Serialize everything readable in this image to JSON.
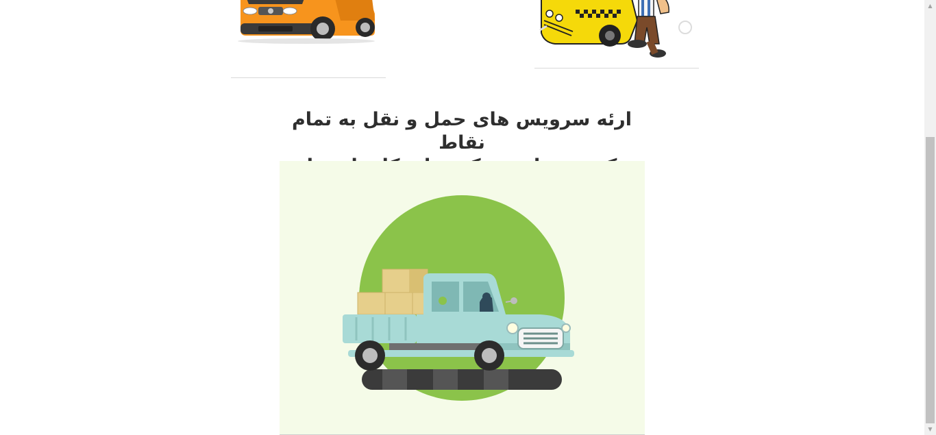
{
  "headline": {
    "line1": "ارئه سرویس های حمل و نقل به تمام نقاط",
    "line2": "کشور برای شرکت ها و کارخانه ها"
  },
  "images": {
    "van": "orange-van-illustration",
    "taxi": "taxi-with-driver-illustration",
    "truck": "pickup-truck-with-hay-bales-illustration"
  },
  "colors": {
    "van_body": "#f7941d",
    "taxi_body": "#f5d90a",
    "truck_body": "#a8dad6",
    "circle": "#8bc34a",
    "illustration_bg": "#f5fbe8",
    "hay": "#e6cf8b",
    "headline_text": "#2e2e2e"
  },
  "scrollbar": {
    "up_arrow": "▲",
    "down_arrow": "▼"
  }
}
